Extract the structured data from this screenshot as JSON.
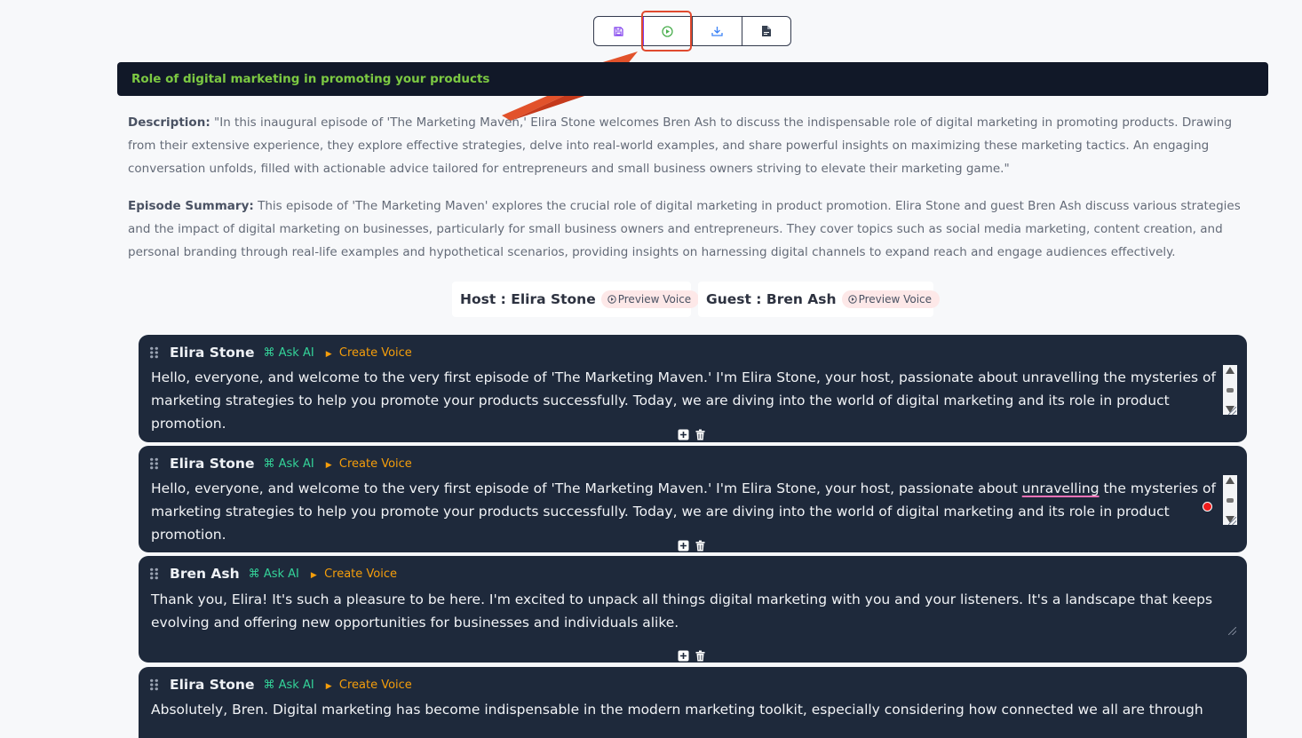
{
  "toolbar": {
    "buttons": [
      {
        "icon": "save-icon",
        "color": "#7c3aed"
      },
      {
        "icon": "play-icon",
        "color": "#4caf50"
      },
      {
        "icon": "download-icon",
        "color": "#3b82f6"
      },
      {
        "icon": "document-icon",
        "color": "#374151"
      }
    ]
  },
  "title": "Role of digital marketing in promoting your products",
  "description": {
    "label": "Description:",
    "text": " \"In this inaugural episode of 'The Marketing Maven,' Elira Stone welcomes Bren Ash to discuss the indispensable role of digital marketing in promoting products. Drawing from their extensive experience, they explore effective strategies, delve into real-world examples, and share powerful insights on maximizing these marketing tactics. An engaging conversation unfolds, filled with actionable advice tailored for entrepreneurs and small business owners striving to elevate their marketing game.\""
  },
  "summary": {
    "label": "Episode Summary:",
    "text": " This episode of 'The Marketing Maven' explores the crucial role of digital marketing in product promotion. Elira Stone and guest Bren Ash discuss various strategies and the impact of digital marketing on businesses, particularly for small business owners and entrepreneurs. They cover topics such as social media marketing, content creation, and personal branding through real-life examples and hypothetical scenarios, providing insights on harnessing digital channels to expand reach and engage audiences effectively."
  },
  "voices": {
    "host": {
      "label": "Host : Elira Stone",
      "preview": "Preview Voice"
    },
    "guest": {
      "label": "Guest : Bren Ash",
      "preview": "Preview Voice"
    }
  },
  "segment_actions": {
    "ask_ai": "Ask AI",
    "create_voice": "Create Voice"
  },
  "segments": [
    {
      "speaker": "Elira Stone",
      "text": "Hello, everyone, and welcome to the very first episode of 'The Marketing Maven.' I'm Elira Stone, your host, passionate about unravelling the mysteries of marketing strategies to help you promote your products successfully. Today, we are diving into the world of digital marketing and its role in product promotion."
    },
    {
      "speaker": "Elira Stone",
      "text_before": "Hello, everyone, and welcome to the very first episode of 'The Marketing Maven.' I'm Elira Stone, your host, passionate about ",
      "text_flagged": "unravelling",
      "text_after": " the mysteries of marketing strategies to help you promote your products successfully. Today, we are diving into the world of digital marketing and its role in product promotion."
    },
    {
      "speaker": "Bren Ash",
      "text": "Thank you, Elira! It's such a pleasure to be here. I'm excited to unpack all things digital marketing with you and your listeners. It's a landscape that keeps evolving and offering new opportunities for businesses and individuals alike."
    },
    {
      "speaker": "Elira Stone",
      "text": "Absolutely, Bren. Digital marketing has become indispensable in the modern marketing toolkit, especially considering how connected we all are through"
    }
  ]
}
